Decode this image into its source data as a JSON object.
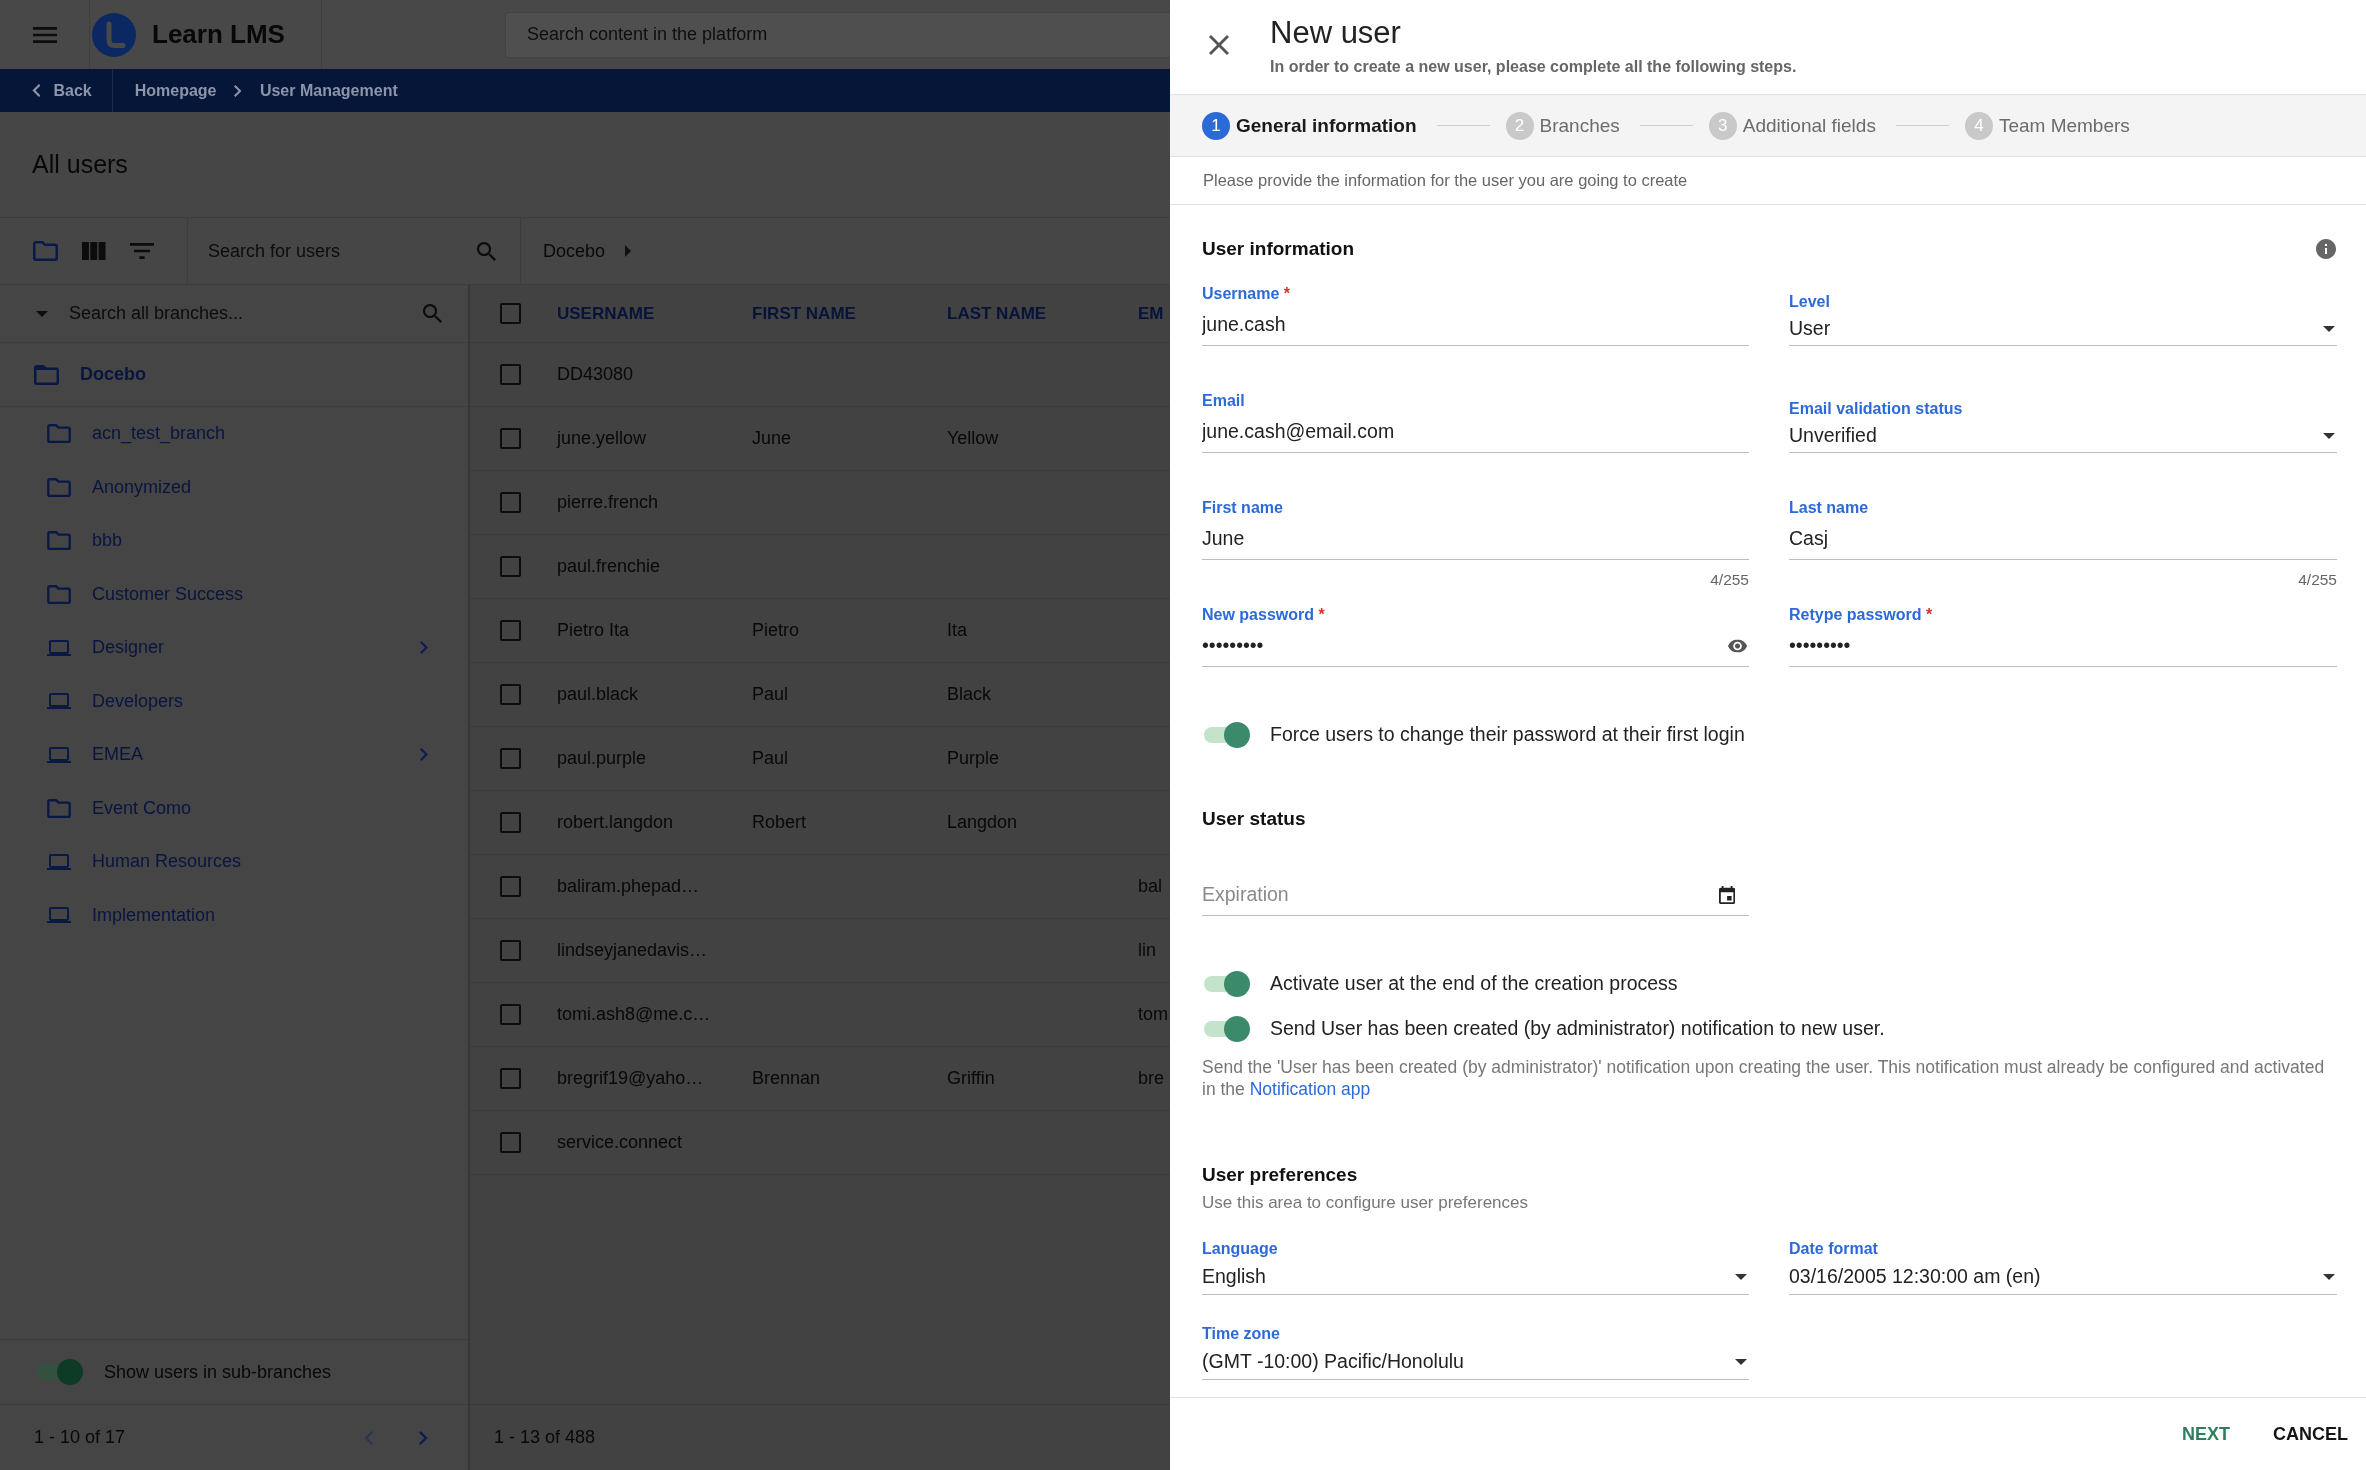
{
  "topbar": {
    "logo_text": "Learn LMS",
    "search_placeholder": "Search content in the platform"
  },
  "breadcrumb": {
    "back": "Back",
    "items": [
      "Homepage",
      "User Management"
    ]
  },
  "page_title": "All users",
  "toolbar": {
    "search_placeholder": "Search for users",
    "path": "Docebo"
  },
  "branches": {
    "search_placeholder": "Search all branches...",
    "root": {
      "label": "Docebo",
      "expanded": true
    },
    "items": [
      {
        "label": "acn_test_branch",
        "kind": "folder",
        "has_children": false
      },
      {
        "label": "Anonymized",
        "kind": "folder",
        "has_children": false
      },
      {
        "label": "bbb",
        "kind": "folder",
        "has_children": false
      },
      {
        "label": "Customer Success",
        "kind": "folder",
        "has_children": false
      },
      {
        "label": "Designer",
        "kind": "device",
        "has_children": true
      },
      {
        "label": "Developers",
        "kind": "device",
        "has_children": false
      },
      {
        "label": "EMEA",
        "kind": "device",
        "has_children": true
      },
      {
        "label": "Event Como",
        "kind": "folder",
        "has_children": false
      },
      {
        "label": "Human Resources",
        "kind": "device",
        "has_children": false
      },
      {
        "label": "Implementation",
        "kind": "device",
        "has_children": false
      }
    ],
    "sub_branches": {
      "label": "Show users in sub-branches",
      "on": true
    },
    "pagination": {
      "label": "1 - 10 of 17",
      "previous_disabled": true,
      "next_disabled": false
    }
  },
  "users": {
    "all_checked": false,
    "columns": [
      "USERNAME",
      "FIRST NAME",
      "LAST NAME",
      "EM"
    ],
    "rows": [
      {
        "checked": false,
        "username": "DD43080"
      },
      {
        "checked": false,
        "username": "june.yellow",
        "first_name": "June",
        "last_name": "Yellow"
      },
      {
        "checked": false,
        "username": "pierre.french"
      },
      {
        "checked": false,
        "username": "paul.frenchie"
      },
      {
        "checked": false,
        "username": "Pietro Ita",
        "first_name": "Pietro",
        "last_name": "Ita"
      },
      {
        "checked": false,
        "username": "paul.black",
        "first_name": "Paul",
        "last_name": "Black"
      },
      {
        "checked": false,
        "username": "paul.purple",
        "first_name": "Paul",
        "last_name": "Purple"
      },
      {
        "checked": false,
        "username": "robert.langdon",
        "first_name": "Robert",
        "last_name": "Langdon"
      },
      {
        "checked": false,
        "username": "baliram.phepad…",
        "column_4": "bal"
      },
      {
        "checked": false,
        "username": "lindseyjanedavis…",
        "column_4": "lin"
      },
      {
        "checked": false,
        "username": "tomi.ash8@me.c…",
        "column_4": "tom"
      },
      {
        "checked": false,
        "username": "bregrif19@yaho…",
        "first_name": "Brennan",
        "last_name": "Griffin",
        "column_4": "bre"
      },
      {
        "checked": false,
        "username": "service.connect"
      }
    ],
    "pagination": "1 - 13 of 488"
  },
  "drawer": {
    "title": "New user",
    "subtitle": "In order to create a new user, please complete all the following steps.",
    "steps": [
      {
        "number": "1",
        "label": "General information",
        "selected": true
      },
      {
        "number": "2",
        "label": "Branches",
        "selected": false
      },
      {
        "number": "3",
        "label": "Additional fields",
        "selected": false
      },
      {
        "number": "4",
        "label": "Team Members",
        "selected": false
      }
    ],
    "intro": "Please provide the information for the user you are going to create",
    "sections": [
      {
        "title": "User information",
        "has_info": true,
        "items": [
          {
            "kind": "text",
            "label": "Username",
            "required_mark": "*",
            "value": "june.cash"
          },
          {
            "kind": "select",
            "label": "Level",
            "value": "User"
          },
          {
            "kind": "text",
            "label": "Email",
            "value": "june.cash@email.com"
          },
          {
            "kind": "select",
            "label": "Email validation status",
            "value": "Unverified"
          },
          {
            "kind": "text",
            "label": "First name",
            "value": "June",
            "counter": "4/255"
          },
          {
            "kind": "text",
            "label": "Last name",
            "value": "Casj",
            "counter": "4/255"
          },
          {
            "kind": "password",
            "label": "New password",
            "required_mark": "*",
            "value": "•••••••••",
            "reveal": true
          },
          {
            "kind": "password",
            "label": "Retype password",
            "required_mark": "*",
            "value": "•••••••••",
            "reveal": false
          },
          {
            "kind": "toggle",
            "label": "Force users to change their password at their first login",
            "on": true
          }
        ]
      },
      {
        "title": "User status",
        "has_info": false,
        "items": [
          {
            "kind": "date",
            "placeholder": "Expiration"
          },
          {
            "kind": "toggle",
            "label": "Activate user at the end of the creation process",
            "on": true
          },
          {
            "kind": "toggle",
            "label": "Send User has been created (by administrator) notification to new user.",
            "on": true
          },
          {
            "kind": "note",
            "text": "Send the 'User has been created (by administrator)' notification upon creating the user. This notification must already be configured and activated in the",
            "link": "Notification app"
          }
        ]
      },
      {
        "title": "User preferences",
        "subtitle": "Use this area to configure user preferences",
        "has_info": false,
        "items": [
          {
            "kind": "select",
            "label": "Language",
            "value": "English"
          },
          {
            "kind": "select",
            "label": "Date format",
            "value": "03/16/2005 12:30:00 am (en)"
          },
          {
            "kind": "select",
            "label": "Time zone",
            "value": "(GMT -10:00) Pacific/Honolulu"
          }
        ]
      }
    ],
    "actions": [
      {
        "kind": "next",
        "label": "NEXT"
      },
      {
        "kind": "cancel",
        "label": "CANCEL"
      }
    ]
  }
}
